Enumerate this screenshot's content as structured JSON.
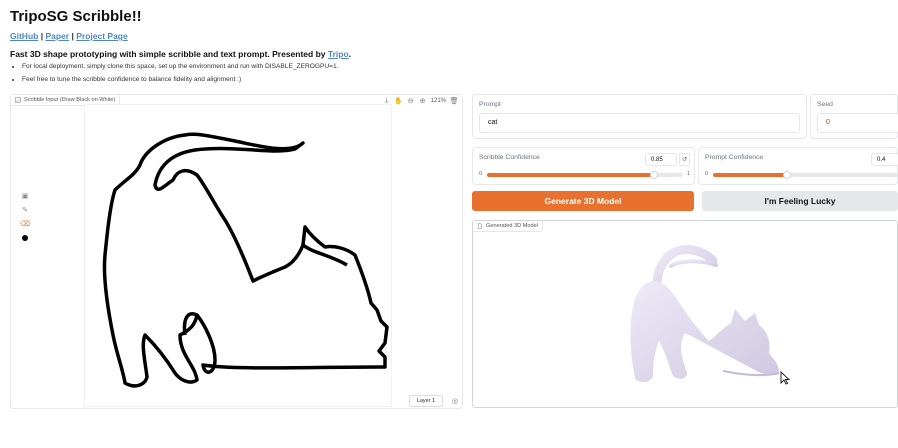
{
  "title": "TripoSG Scribble!!",
  "links": {
    "github": "GitHub",
    "sep1": "|",
    "paper": "Paper",
    "sep2": "|",
    "project": "Project Page"
  },
  "subtitle": {
    "text": "Fast 3D shape prototyping with simple scribble and text prompt. Presented by ",
    "link": "Tripo",
    "end": "."
  },
  "bullets": [
    "For local deployment, simply clone this space, set up the environment and run with DISABLE_ZEROGPU=1.",
    "Feel free to tune the scribble confidence to balance fidelity and alignment :)"
  ],
  "sketch": {
    "label": "Scribble Input (Draw Black on White)",
    "zoom": "121%",
    "layer": "Layer 1",
    "brush_color": "#000000",
    "icons": [
      "download-icon",
      "pan-icon",
      "zoom-out-icon",
      "zoom-in-icon",
      "delete-icon"
    ],
    "side_icons": [
      "image-icon",
      "brush-icon",
      "eraser-icon",
      "color-icon"
    ]
  },
  "prompt": {
    "label": "Prompt",
    "value": "cat"
  },
  "seed": {
    "label": "Seed",
    "value": "0"
  },
  "scribble_conf": {
    "label": "Scribble Confidence",
    "value": "0.85",
    "min": "0",
    "max": "1",
    "fraction": 0.85
  },
  "prompt_conf": {
    "label": "Prompt Confidence",
    "value": "0.4",
    "min": "0",
    "fraction": 0.4
  },
  "buttons": {
    "generate": "Generate 3D Model",
    "lucky": "I'm Feeling Lucky"
  },
  "model": {
    "label": "Generated 3D Model"
  },
  "colors": {
    "accent": "#e8712e",
    "link": "#4f86c6",
    "model": "#ddd6ec"
  }
}
